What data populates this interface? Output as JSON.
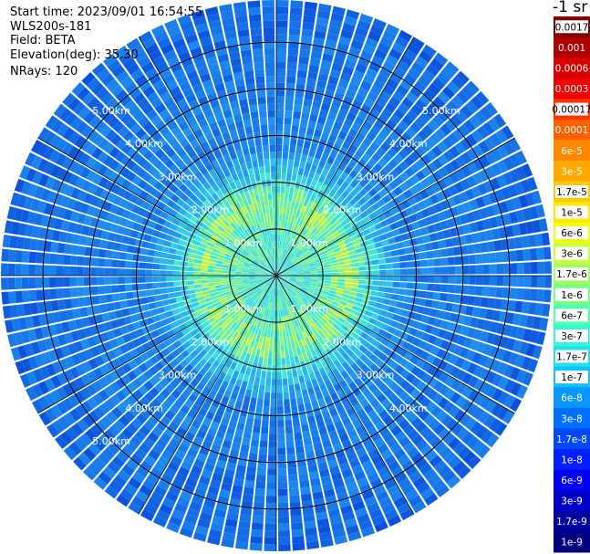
{
  "header": {
    "start_time": "Start time: 2023/09/01 16:54:55",
    "instrument": "WLS200s-181",
    "field": "Field: BETA",
    "elevation": "Elevation(deg): 35.30",
    "nrays": "NRays: 120"
  },
  "chart_data": {
    "type": "heatmap",
    "projection": "polar",
    "field": "BETA",
    "n_rays": 120,
    "range_rings_km": [
      1,
      2,
      3,
      4,
      5
    ],
    "max_range_km": 5.9,
    "spoke_angles_deg": [
      0,
      30,
      60,
      90,
      120,
      150,
      180,
      210,
      240,
      270,
      300,
      330
    ],
    "ring_labels": [
      {
        "text": "1.00km",
        "km": 1,
        "angle_deg": 315
      },
      {
        "text": "1.00km",
        "km": 1,
        "angle_deg": 45
      },
      {
        "text": "1.00km",
        "km": 1,
        "angle_deg": 225
      },
      {
        "text": "1.00km",
        "km": 1,
        "angle_deg": 135
      },
      {
        "text": "2.00km",
        "km": 2,
        "angle_deg": 315
      },
      {
        "text": "2.00km",
        "km": 2,
        "angle_deg": 45
      },
      {
        "text": "2.00km",
        "km": 2,
        "angle_deg": 225
      },
      {
        "text": "2.00km",
        "km": 2,
        "angle_deg": 135
      },
      {
        "text": "3.00km",
        "km": 3,
        "angle_deg": 315
      },
      {
        "text": "3.00km",
        "km": 3,
        "angle_deg": 45
      },
      {
        "text": "3.00km",
        "km": 3,
        "angle_deg": 225
      },
      {
        "text": "3.00km",
        "km": 3,
        "angle_deg": 135
      },
      {
        "text": "4.00km",
        "km": 4,
        "angle_deg": 315
      },
      {
        "text": "4.00km",
        "km": 4,
        "angle_deg": 45
      },
      {
        "text": "4.00km",
        "km": 4,
        "angle_deg": 225
      },
      {
        "text": "4.00km",
        "km": 4,
        "angle_deg": 135
      },
      {
        "text": "5.00km",
        "km": 5,
        "angle_deg": 315
      },
      {
        "text": "5.00km",
        "km": 5,
        "angle_deg": 45
      },
      {
        "text": "5.00km",
        "km": 5,
        "angle_deg": 225
      }
    ],
    "colorbar": {
      "title": "-1 sr",
      "labels": [
        "0.0017",
        "0.001",
        "0.0006",
        "0.0003",
        "0.00017",
        "0.0001",
        "6e-5",
        "3e-5",
        "1.7e-5",
        "1e-5",
        "6e-6",
        "3e-6",
        "1.7e-6",
        "1e-6",
        "6e-7",
        "3e-7",
        "1.7e-7",
        "1e-7",
        "6e-8",
        "3e-8",
        "1.7e-8",
        "1e-8",
        "6e-9",
        "3e-9",
        "1.7e-9",
        "1e-9"
      ],
      "colors": [
        "#800000",
        "#b00000",
        "#d80000",
        "#f00000",
        "#ff3000",
        "#ff6000",
        "#ff8800",
        "#ffa800",
        "#ffc800",
        "#ffe800",
        "#f0ff10",
        "#c8ff38",
        "#a0ff60",
        "#78ff88",
        "#50ffb0",
        "#30f8d8",
        "#20e0f0",
        "#10c0ff",
        "#0898ff",
        "#0070ff",
        "#0048ff",
        "#0020ff",
        "#0000f0",
        "#0000c8",
        "#0000a0",
        "#000080"
      ],
      "selected_text_color": "#000000",
      "default_text_color": "#ffffff",
      "black_text_labels": [
        "0.0017",
        "0.00017",
        "1.7e-5",
        "1e-5",
        "6e-6",
        "3e-6",
        "1.7e-6",
        "1e-6",
        "6e-7",
        "3e-7",
        "1.7e-7",
        "1e-7"
      ]
    }
  }
}
